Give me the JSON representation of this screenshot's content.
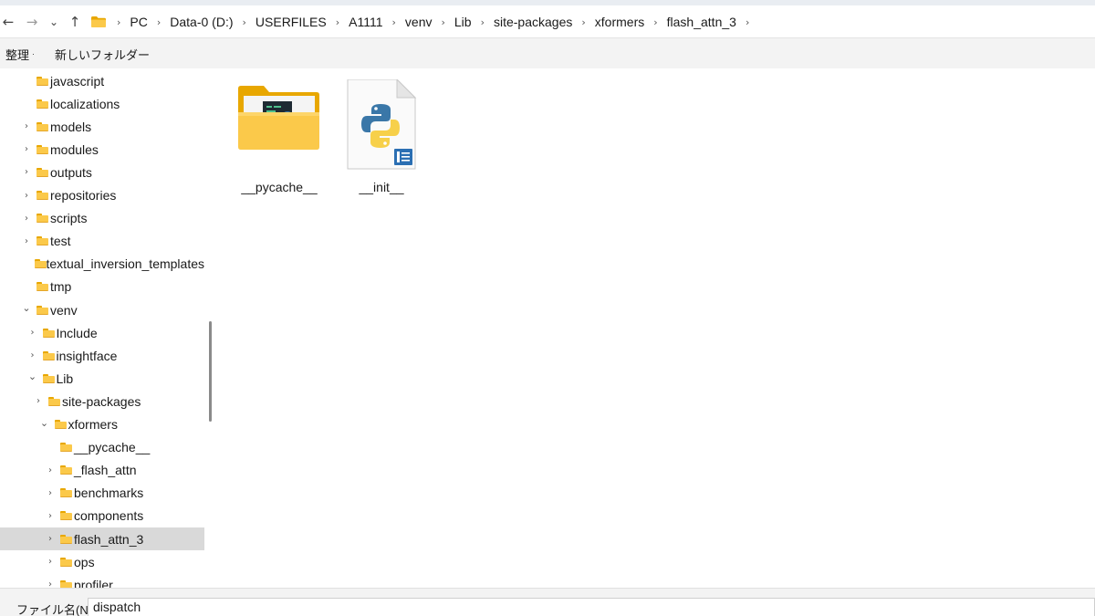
{
  "nav": {
    "back_glyph": "←",
    "forward_glyph": "→",
    "recent_glyph": "⌄",
    "up_glyph": "↑"
  },
  "breadcrumb": [
    "PC",
    "Data-0 (D:)",
    "USERFILES",
    "A1111",
    "venv",
    "Lib",
    "site-packages",
    "xformers",
    "flash_attn_3"
  ],
  "toolbar": {
    "organize_label": "整理",
    "new_folder_label": "新しいフォルダー"
  },
  "tree": [
    {
      "label": "javascript",
      "indent": 0,
      "expander": "none"
    },
    {
      "label": "localizations",
      "indent": 0,
      "expander": "none"
    },
    {
      "label": "models",
      "indent": 0,
      "expander": "collapsed"
    },
    {
      "label": "modules",
      "indent": 0,
      "expander": "collapsed"
    },
    {
      "label": "outputs",
      "indent": 0,
      "expander": "collapsed"
    },
    {
      "label": "repositories",
      "indent": 0,
      "expander": "collapsed"
    },
    {
      "label": "scripts",
      "indent": 0,
      "expander": "collapsed"
    },
    {
      "label": "test",
      "indent": 0,
      "expander": "collapsed"
    },
    {
      "label": "textual_inversion_templates",
      "indent": 0,
      "expander": "none"
    },
    {
      "label": "tmp",
      "indent": 0,
      "expander": "none"
    },
    {
      "label": "venv",
      "indent": 0,
      "expander": "expanded"
    },
    {
      "label": "Include",
      "indent": 1,
      "expander": "collapsed"
    },
    {
      "label": "insightface",
      "indent": 1,
      "expander": "collapsed"
    },
    {
      "label": "Lib",
      "indent": 1,
      "expander": "expanded"
    },
    {
      "label": "site-packages",
      "indent": 2,
      "expander": "collapsed"
    },
    {
      "label": "xformers",
      "indent": 3,
      "expander": "expanded"
    },
    {
      "label": "__pycache__",
      "indent": 4,
      "expander": "none"
    },
    {
      "label": "_flash_attn",
      "indent": 4,
      "expander": "collapsed"
    },
    {
      "label": "benchmarks",
      "indent": 4,
      "expander": "collapsed"
    },
    {
      "label": "components",
      "indent": 4,
      "expander": "collapsed"
    },
    {
      "label": "flash_attn_3",
      "indent": 4,
      "expander": "collapsed",
      "selected": true
    },
    {
      "label": "ops",
      "indent": 4,
      "expander": "collapsed"
    },
    {
      "label": "profiler",
      "indent": 4,
      "expander": "collapsed"
    }
  ],
  "files": [
    {
      "name": "__pycache__",
      "kind": "folder",
      "icon": "folder-with-files-icon"
    },
    {
      "name": "__init__",
      "kind": "python",
      "icon": "python-file-icon"
    }
  ],
  "filename": {
    "label": "ファイル名(N):",
    "value": "dispatch"
  },
  "colors": {
    "folder_yellow": "#fbc94a",
    "folder_dark": "#e8a700",
    "python_blue": "#3a77a8",
    "python_yellow": "#f7d04a",
    "selection": "#d9d9d9"
  }
}
